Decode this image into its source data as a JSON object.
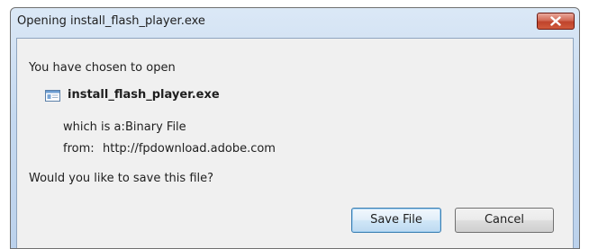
{
  "window": {
    "title": "Opening install_flash_player.exe",
    "close_icon": "close-x-icon"
  },
  "dialog": {
    "intro": "You have chosen to open",
    "file_icon": "application-window-icon",
    "file_name": "install_flash_player.exe",
    "which_is_label": "which is a:",
    "which_is_value": "Binary File",
    "from_label": "from:",
    "from_value": "http://fpdownload.adobe.com",
    "question": "Would you like to save this file?"
  },
  "buttons": {
    "save": "Save File",
    "cancel": "Cancel"
  },
  "colors": {
    "title_bar": "#c5d9f0",
    "close_button": "#c0442c",
    "content_bg": "#f0f0f0",
    "default_button_border": "#3c7fb1"
  }
}
